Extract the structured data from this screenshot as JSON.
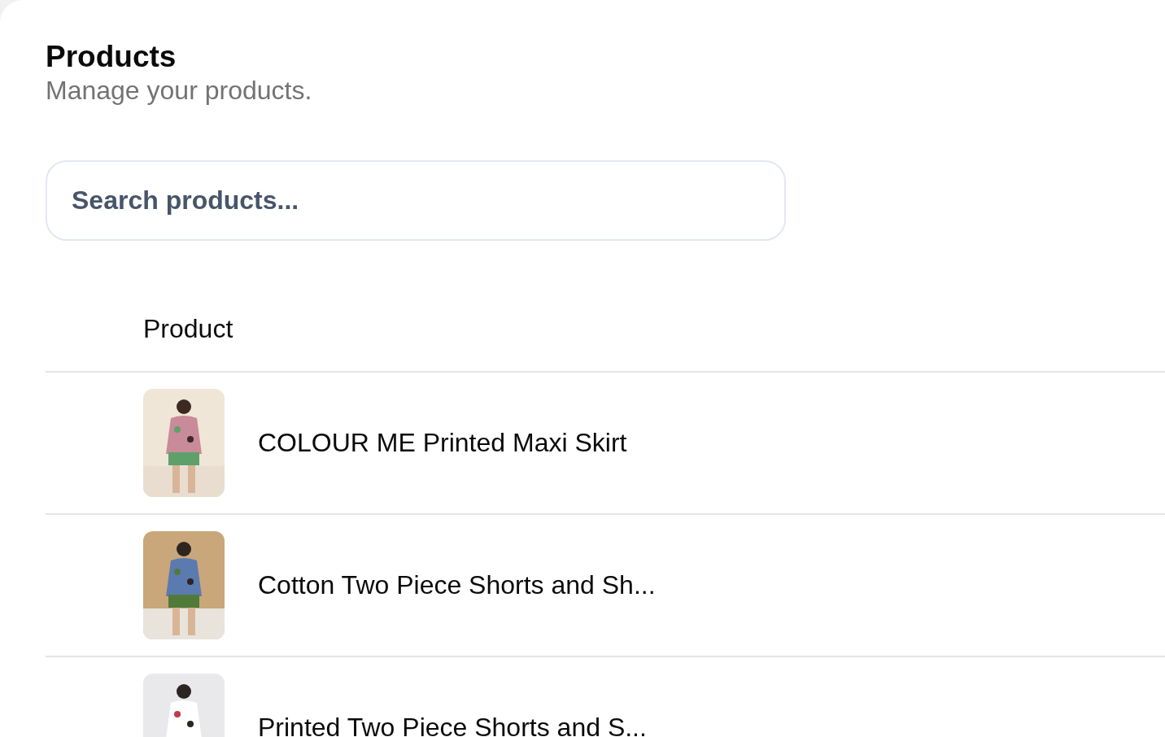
{
  "header": {
    "title": "Products",
    "subtitle": "Manage your products."
  },
  "search": {
    "placeholder": "Search products..."
  },
  "table": {
    "columns": [
      "Product"
    ],
    "rows": [
      {
        "name": "COLOUR ME Printed Maxi Skirt"
      },
      {
        "name": "Cotton Two Piece Shorts and Sh..."
      },
      {
        "name": "Printed Two Piece Shorts and S..."
      }
    ]
  }
}
